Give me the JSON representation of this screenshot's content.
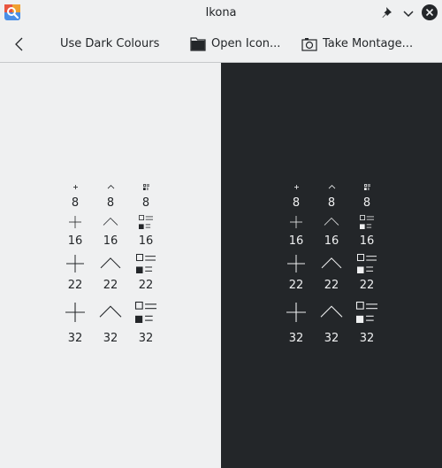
{
  "window": {
    "title": "Ikona",
    "app_icon": "ikona-app-icon",
    "buttons": [
      "pin-icon",
      "minimize-icon",
      "close-icon"
    ]
  },
  "toolbar": {
    "back_icon": "back-arrow-icon",
    "dark_colours_label": "Use Dark Colours",
    "open_icon_label": "Open Icon...",
    "open_icon_icon": "folder-icon",
    "montage_label": "Take Montage...",
    "montage_icon": "camera-icon"
  },
  "preview": {
    "icons": [
      "add-icon",
      "go-up-icon",
      "view-list-details-icon"
    ],
    "light": {
      "sizes": [
        {
          "label": "8"
        },
        {
          "label": "16"
        },
        {
          "label": "22"
        },
        {
          "label": "32"
        }
      ]
    },
    "dark": {
      "sizes": [
        {
          "label": "8"
        },
        {
          "label": "16"
        },
        {
          "label": "22"
        },
        {
          "label": "32"
        }
      ]
    }
  },
  "colors": {
    "light_background": "#eff0f1",
    "dark_background": "#232629",
    "light_foreground": "#232629",
    "dark_foreground": "#eff0f1"
  }
}
